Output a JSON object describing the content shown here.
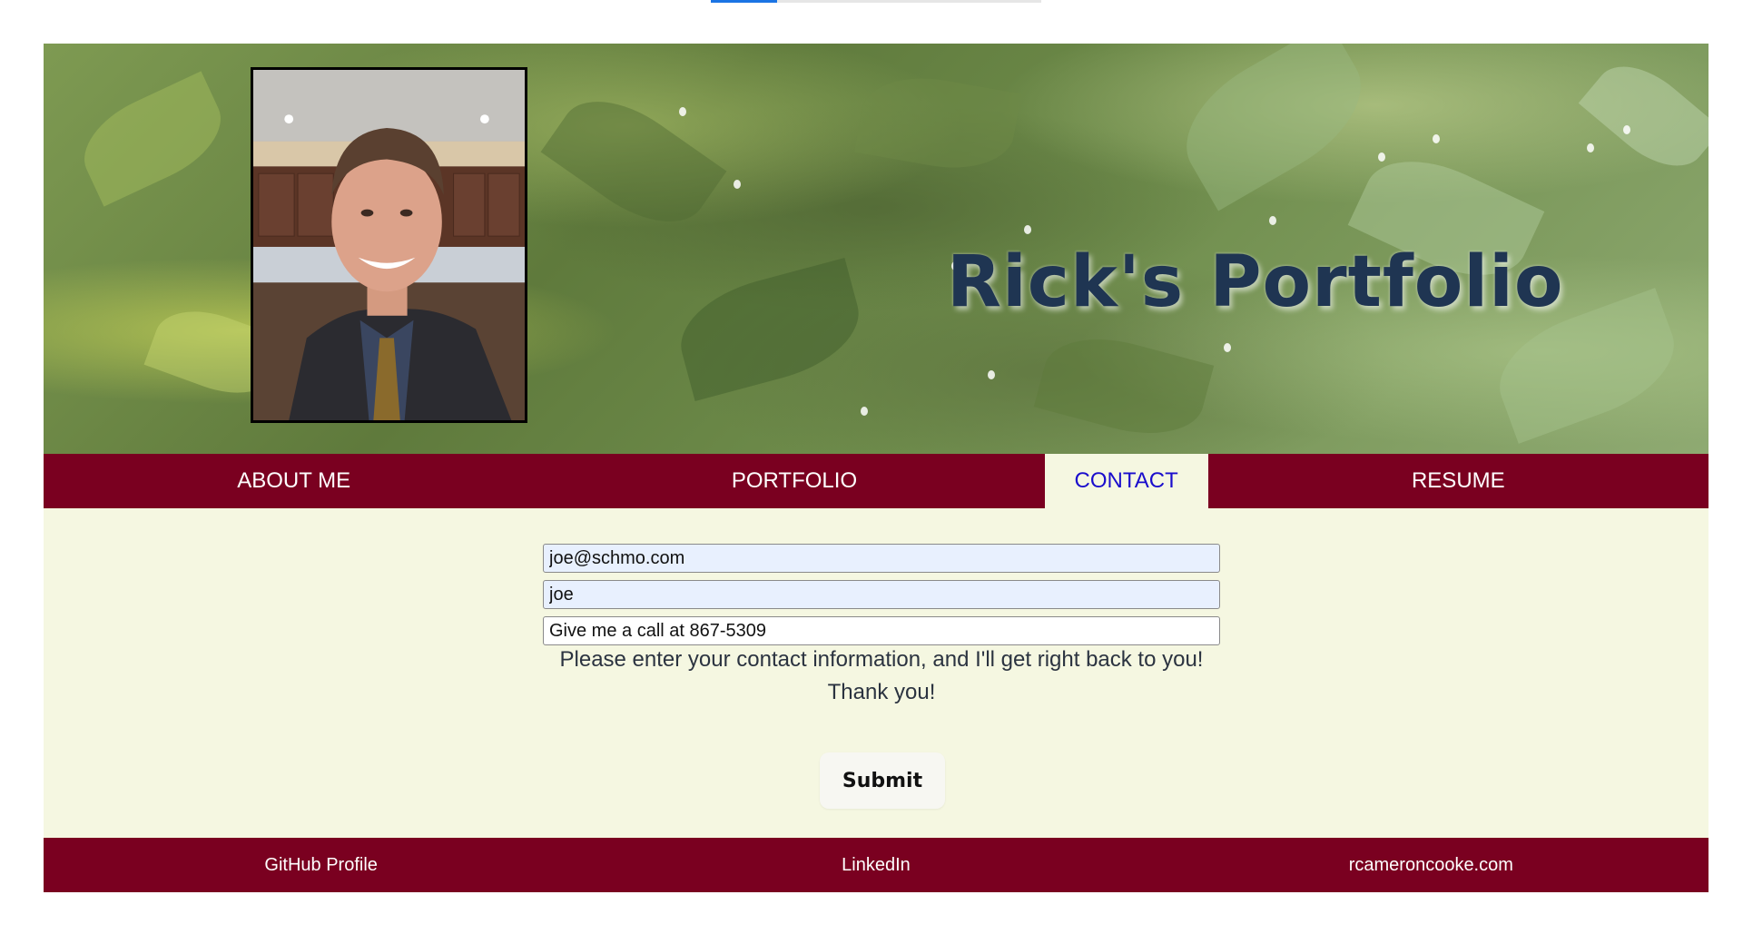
{
  "page": {
    "scroll_progress_percent": 20
  },
  "header": {
    "title": "Rick's Portfolio",
    "photo_icon": "portrait-photo"
  },
  "nav": {
    "items": [
      {
        "label": "ABOUT ME",
        "active": false
      },
      {
        "label": "PORTFOLIO",
        "active": false
      },
      {
        "label": "CONTACT",
        "active": true
      },
      {
        "label": "RESUME",
        "active": false
      }
    ]
  },
  "contact_form": {
    "email_value": "joe@schmo.com",
    "name_value": "joe",
    "message_value": "Give me a call at 867-5309",
    "instructions": "Please enter your contact information, and I'll get right back to you!",
    "thanks": "Thank you!",
    "submit_label": "Submit"
  },
  "footer": {
    "links": [
      {
        "label": "GitHub Profile"
      },
      {
        "label": "LinkedIn"
      },
      {
        "label": "rcameroncooke.com"
      }
    ]
  },
  "colors": {
    "brand_maroon": "#7a0020",
    "content_background": "#f5f7e1",
    "title_color": "#1f3552",
    "active_nav_text": "#1a0dcc"
  }
}
